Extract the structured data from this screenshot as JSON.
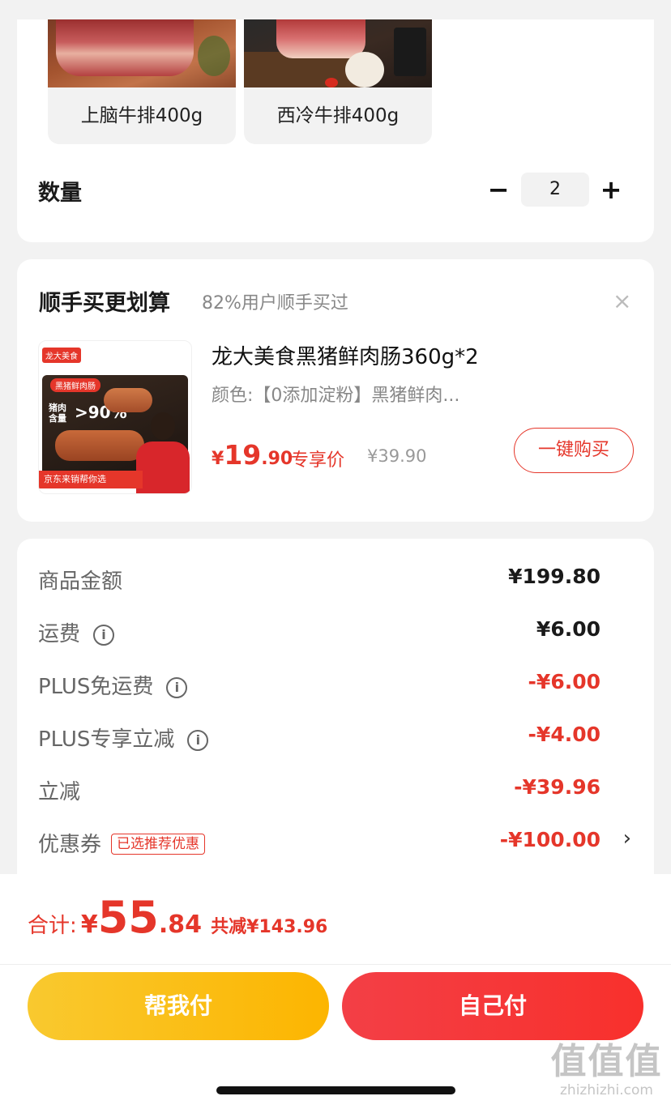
{
  "variants": [
    {
      "label": "上脑牛排400g"
    },
    {
      "label": "西冷牛排400g"
    }
  ],
  "quantity": {
    "label": "数量",
    "minus": "−",
    "value": "2",
    "plus": "+"
  },
  "upsell": {
    "title": "顺手买更划算",
    "subtitle": "82%用户顺手买过",
    "close": "×",
    "product": {
      "image_badge_brand": "龙大美食",
      "image_badge_type": "黑猪鲜肉肠",
      "image_claim_line1": "猪肉",
      "image_claim_line2": "含量",
      "image_claim_value": ">90%",
      "image_footer": "京东来销帮你选",
      "name": "龙大美食黑猪鲜肉肠360g*2",
      "spec": "颜色:【0添加淀粉】黑猪鲜肉...",
      "price_currency": "¥",
      "price_int": "19",
      "price_dec": ".90",
      "price_tag": "专享价",
      "original_price": "¥39.90",
      "buy_button": "一键购买"
    }
  },
  "breakdown": {
    "rows": [
      {
        "label": "商品金额",
        "value": "¥199.80"
      },
      {
        "label": "运费",
        "value": "¥6.00"
      },
      {
        "label": "PLUS免运费",
        "value": "-¥6.00"
      },
      {
        "label": "PLUS专享立减",
        "value": "-¥4.00"
      },
      {
        "label": "立减",
        "value": "-¥39.96"
      },
      {
        "label": "优惠券",
        "tag": "已选推荐优惠",
        "value": "-¥100.00",
        "chevron": "›"
      }
    ],
    "info_icon": "i"
  },
  "total": {
    "label": "合计:",
    "currency": "¥",
    "int": "55",
    "dec": ".84",
    "saved": "共减¥143.96"
  },
  "buttons": {
    "help_pay": "帮我付",
    "self_pay": "自己付"
  },
  "watermark": {
    "big": "值值值",
    "small": "zhizhizhi.com"
  },
  "colors": {
    "accent_red": "#e5362a",
    "help_pay_yellow": "#fcb500",
    "self_pay_red": "#f33f46"
  }
}
